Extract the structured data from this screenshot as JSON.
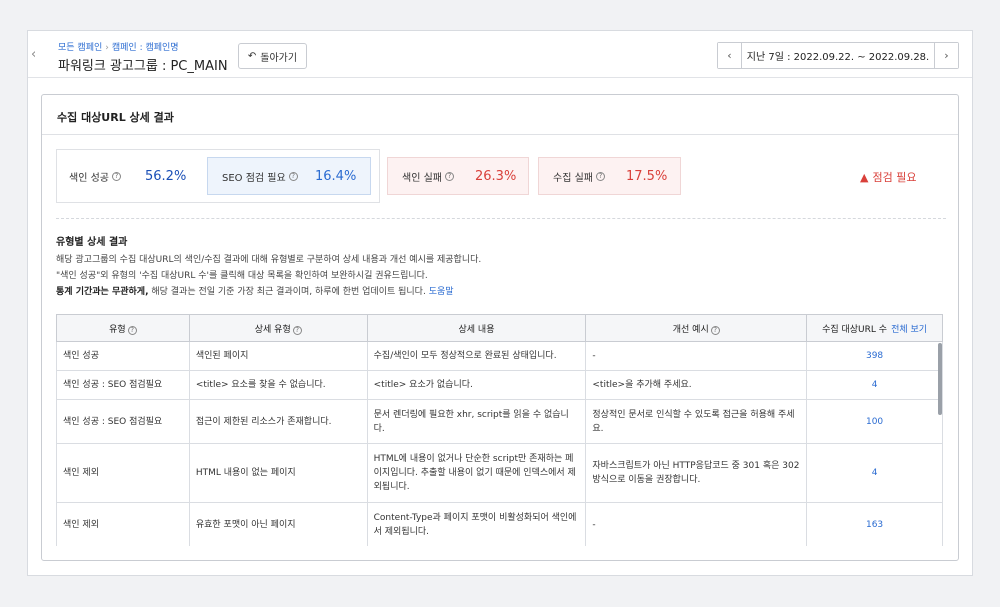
{
  "breadcrumb": [
    "모든 캠페인",
    "캠페인 : 캠페인명"
  ],
  "page_title": "파워링크 광고그룹 : PC_MAIN",
  "back_button": "돌아가기",
  "date_range": "지난 7일 : 2022.09.22. ~ 2022.09.28.",
  "panel_title": "수집 대상URL 상세 결과",
  "stats": [
    {
      "label": "색인 성공",
      "value": "56.2%"
    },
    {
      "label": "SEO 점검 필요",
      "value": "16.4%"
    },
    {
      "label": "색인 실패",
      "value": "26.3%"
    },
    {
      "label": "수집 실패",
      "value": "17.5%"
    }
  ],
  "warning": "점검 필요",
  "section_title": "유형별 상세 결과",
  "desc_line1": "해당 광고그룹의 수집 대상URL의 색인/수집 결과에 대해 유형별로 구분하여 상세 내용과 개선 예시를 제공합니다.",
  "desc_line2": "\"색인 성공\"외 유형의 '수집 대상URL 수'를 클릭해 대상 목록을 확인하여 보완하시길 권유드립니다.",
  "desc_line3_bold": "통계 기간과는 무관하게,",
  "desc_line3_rest": " 해당 결과는 전일 기준 가장 최근 결과이며, 하루에 한번 업데이트 됩니다.",
  "help_link": "도움말",
  "table": {
    "headers": [
      "유형",
      "상세 유형",
      "상세 내용",
      "개선 예시",
      "수집 대상URL 수"
    ],
    "view_all": "전체 보기",
    "rows": [
      {
        "type": "색인 성공",
        "detail_type": "색인된 페이지",
        "detail": "수집/색인이 모두 정상적으로 완료된 상태입니다.",
        "example": "-",
        "count": "398"
      },
      {
        "type": "색인 성공 : SEO 점검필요",
        "detail_type": "<title> 요소를 찾을 수 없습니다.",
        "detail": "<title> 요소가 없습니다.",
        "example": "<title>을 추가해 주세요.",
        "count": "4"
      },
      {
        "type": "색인 성공 : SEO 점검필요",
        "detail_type": "접근이 제한된 리소스가 존재합니다.",
        "detail": "문서 렌더링에 필요한 xhr, script를 읽을 수 없습니다.",
        "example": "정상적인 문서로 인식할 수 있도록 접근을 허용해 주세요.",
        "count": "100"
      },
      {
        "type": "색인 제외",
        "detail_type": "HTML 내용이 없는 페이지",
        "detail": "HTML에 내용이 없거나 단순한 script만 존재하는 페이지입니다. 추출할 내용이 없기 때문에 인덱스에서 제외됩니다.",
        "example": "자바스크립트가 아닌 HTTP응답코드 중 301 혹은 302 방식으로 이동을 권장합니다.",
        "count": "4"
      },
      {
        "type": "색인 제외",
        "detail_type": "유효한 포맷이 아닌 페이지",
        "detail": "Content-Type과 페이지 포맷이 비활성화되어 색인에서 제외됩니다.",
        "example": "-",
        "count": "163"
      }
    ]
  }
}
